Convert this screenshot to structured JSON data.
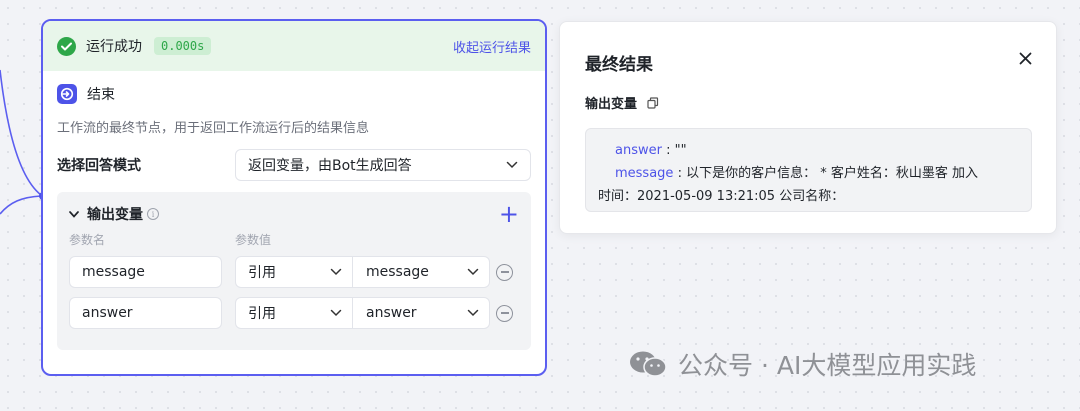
{
  "node": {
    "status_label": "运行成功",
    "status_time": "0.000s",
    "collapse_label": "收起运行结果",
    "title": "结束",
    "description": "工作流的最终节点，用于返回工作流运行后的结果信息",
    "mode_label": "选择回答模式",
    "mode_value": "返回变量，由Bot生成回答",
    "outputs": {
      "title": "输出变量",
      "col_name": "参数名",
      "col_value": "参数值",
      "rows": [
        {
          "name": "message",
          "type": "引用",
          "ref": "message"
        },
        {
          "name": "answer",
          "type": "引用",
          "ref": "answer"
        }
      ]
    }
  },
  "result": {
    "title": "最终结果",
    "sub_label": "输出变量",
    "answer_key": "answer",
    "answer_value": " : \"\"",
    "message_key": "message",
    "message_value": " : 以下是你的客户信息： * 客户姓名：秋山墨客 加入",
    "message_value_cont": "时间：2021-05-09 13:21:05 公司名称："
  },
  "watermark": "公众号 · AI大模型应用实践",
  "colors": {
    "accent": "#4d53e8",
    "success": "#2ea749",
    "node_border": "#5b5ef0"
  }
}
